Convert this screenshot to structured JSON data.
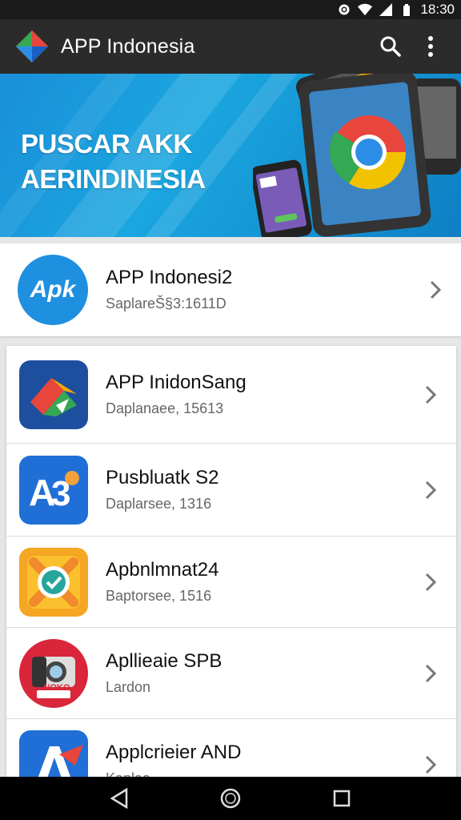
{
  "status": {
    "time": "18:30"
  },
  "app_bar": {
    "title": "APP Indonesia"
  },
  "banner": {
    "line1": "PUSCAR AKK",
    "line2": "AERINDINESIA"
  },
  "featured": {
    "title": "APP Indonesi2",
    "subtitle": "SaplareŠ§3:1611D",
    "icon_text": "Apk"
  },
  "items": [
    {
      "title": "APP InidonSang",
      "subtitle": "Daplanaee, 15613",
      "icon": "maps-icon"
    },
    {
      "title": "Pusbluatk S2",
      "subtitle": "Daplarsee, 1316",
      "icon": "a-logo-icon"
    },
    {
      "title": "Apbnlmnat24",
      "subtitle": "Baptorsee, 1516",
      "icon": "checkmark-badge-icon"
    },
    {
      "title": "Apllieaie SPB",
      "subtitle": "Lardon",
      "icon": "camera-icon",
      "icon_label": "NOKO"
    },
    {
      "title": "Applcrieier AND",
      "subtitle": "Kaplaa",
      "icon": "a-arrow-icon"
    }
  ],
  "colors": {
    "app_bar": "#2b2b2b",
    "banner": "#1aa6e0",
    "accent_blue": "#1f6fd6"
  }
}
